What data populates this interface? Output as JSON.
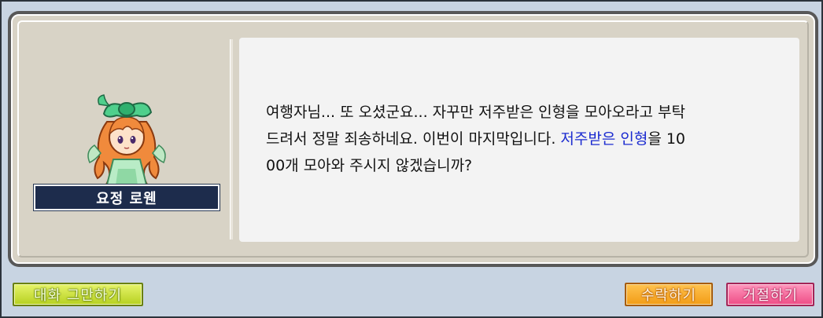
{
  "npc": {
    "name": "요정 로웬",
    "portrait_icon": "fairy-npc-portrait"
  },
  "dialog": {
    "line1": "여행자님... 또 오셨군요... 자꾸만 저주받은 인형을 모아오라고 부탁",
    "line2_before": "드려서 정말 죄송하네요. 이번이 마지막입니다. ",
    "line2_highlight": "저주받은 인형",
    "line2_after": "을 10",
    "line3": "00개 모아와 주시지 않겠습니까?"
  },
  "buttons": {
    "end_chat": "대화 그만하기",
    "accept": "수락하기",
    "decline": "거절하기"
  },
  "colors": {
    "highlight": "#1a2ad0",
    "nameplate": "#1d2c4c",
    "end_button": "#c8e03a",
    "accept_button": "#f7ad2c",
    "decline_button": "#f56a9c"
  }
}
